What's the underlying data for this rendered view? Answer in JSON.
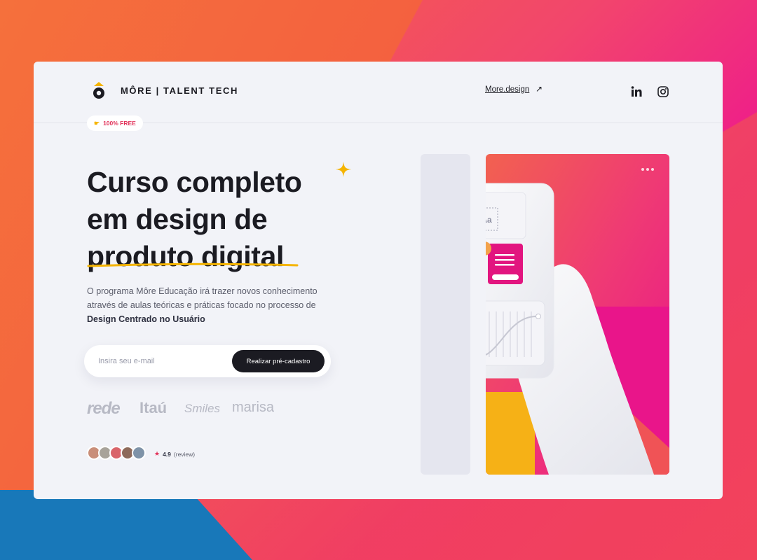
{
  "brand": {
    "name": "MÔRE | TALENT TECH",
    "accent": "#f5b400",
    "dark": "#1b1b22",
    "pink": "#e2157f"
  },
  "header": {
    "link_label": "More.design",
    "link_icon": "arrow-up-right-icon",
    "social": [
      "linkedin-icon",
      "instagram-icon"
    ]
  },
  "badge": {
    "label": "100% FREE",
    "icon": "pointing-hand-icon"
  },
  "hero": {
    "title_lines": [
      "Curso completo",
      "em design de",
      "produto digital"
    ],
    "description": "O programa Môre Educação irá trazer novos conhecimento através de aulas teóricas e práticas focado no processo de",
    "description_bold": "Design Centrado no Usuário"
  },
  "form": {
    "placeholder": "Insira seu e-mail",
    "button_label": "Realizar pré-cadastro"
  },
  "partners": [
    "rede",
    "Itaú",
    "Smiles",
    "marisa"
  ],
  "reviews": {
    "rating": "4.9",
    "label": "(review)",
    "avatar_count": 5
  },
  "illustration": {
    "card_text": "Aa"
  }
}
